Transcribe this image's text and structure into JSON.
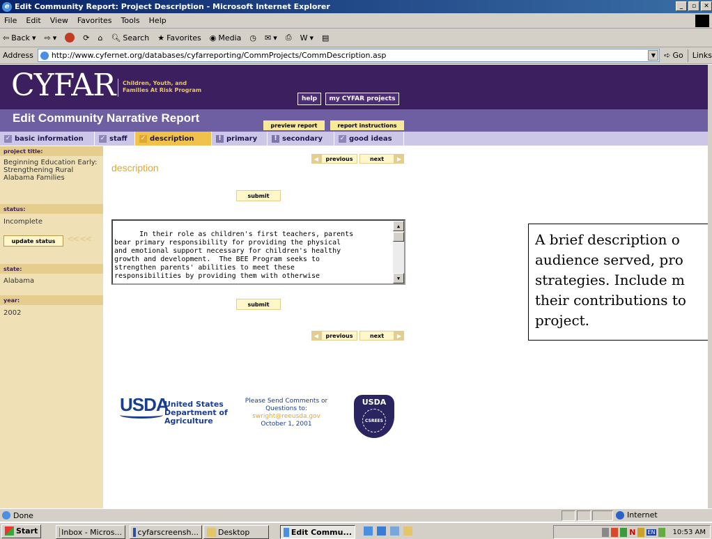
{
  "window": {
    "title": "Edit Community Report: Project Description - Microsoft Internet Explorer"
  },
  "menu": [
    "File",
    "Edit",
    "View",
    "Favorites",
    "Tools",
    "Help"
  ],
  "toolbar": {
    "back": "Back",
    "search": "Search",
    "favorites": "Favorites",
    "media": "Media"
  },
  "address": {
    "label": "Address",
    "url": "http://www.cyfernet.org/databases/cyfarreporting/CommProjects/CommDescription.asp",
    "go": "Go",
    "links": "Links"
  },
  "banner": {
    "logo": "CYFAR",
    "tagline_1": "Children, Youth, and",
    "tagline_2": "Families At Risk Program",
    "help": "help",
    "my_projects": "my CYFAR projects"
  },
  "header": {
    "title": "Edit Community Narrative Report",
    "preview": "preview report",
    "instructions": "report instructions"
  },
  "tabs": [
    {
      "label": "basic information",
      "state": "check"
    },
    {
      "label": "staff",
      "state": "check"
    },
    {
      "label": "description",
      "state": "active"
    },
    {
      "label": "primary",
      "state": "excl"
    },
    {
      "label": "secondary",
      "state": "excl"
    },
    {
      "label": "good ideas",
      "state": "check"
    }
  ],
  "sidebar": {
    "project_title_label": "project title:",
    "project_title": "Beginning Education Early: Strengthening Rural Alabama Families",
    "status_label": "status:",
    "status": "Incomplete",
    "update_status": "update status",
    "state_label": "state:",
    "state": "Alabama",
    "year_label": "year:",
    "year": "2002"
  },
  "main": {
    "section_title": "description",
    "previous": "previous",
    "next": "next",
    "submit": "submit",
    "description_text": "  In their role as children's first teachers, parents\nbear primary responsibility for providing the physical\nand emotional support necessary for children's healthy\ngrowth and development.  The BEE Program seeks to\nstrengthen parents' abilities to meet these\nresponsibilities by providing them with otherwise"
  },
  "tooltip": {
    "line1": "A brief description o",
    "line2": "audience served, pro",
    "line3": "strategies. Include m",
    "line4": "their contributions to",
    "line5": "project."
  },
  "footer": {
    "usda": "USDA",
    "dept_1": "United States",
    "dept_2": "Department of",
    "dept_3": "Agriculture",
    "comments_1": "Please Send Comments or",
    "comments_2": "Questions to:",
    "email": "swright@reeusda.gov",
    "date": "October 1, 2001",
    "seal_text": "USDA",
    "seal_inner": "CSREES"
  },
  "statusbar": {
    "left": "Done",
    "zone": "Internet"
  },
  "taskbar": {
    "start": "Start",
    "tasks": [
      "Inbox - Micros...",
      "cyfarscreensh...",
      "Desktop",
      "Edit Commu..."
    ],
    "clock": "10:53 AM",
    "lang": "EN"
  },
  "colors": {
    "banner": "#3c1f5e",
    "header": "#6d5fa1",
    "tab_active": "#f0c24b",
    "sidebar": "#efe1b5"
  }
}
